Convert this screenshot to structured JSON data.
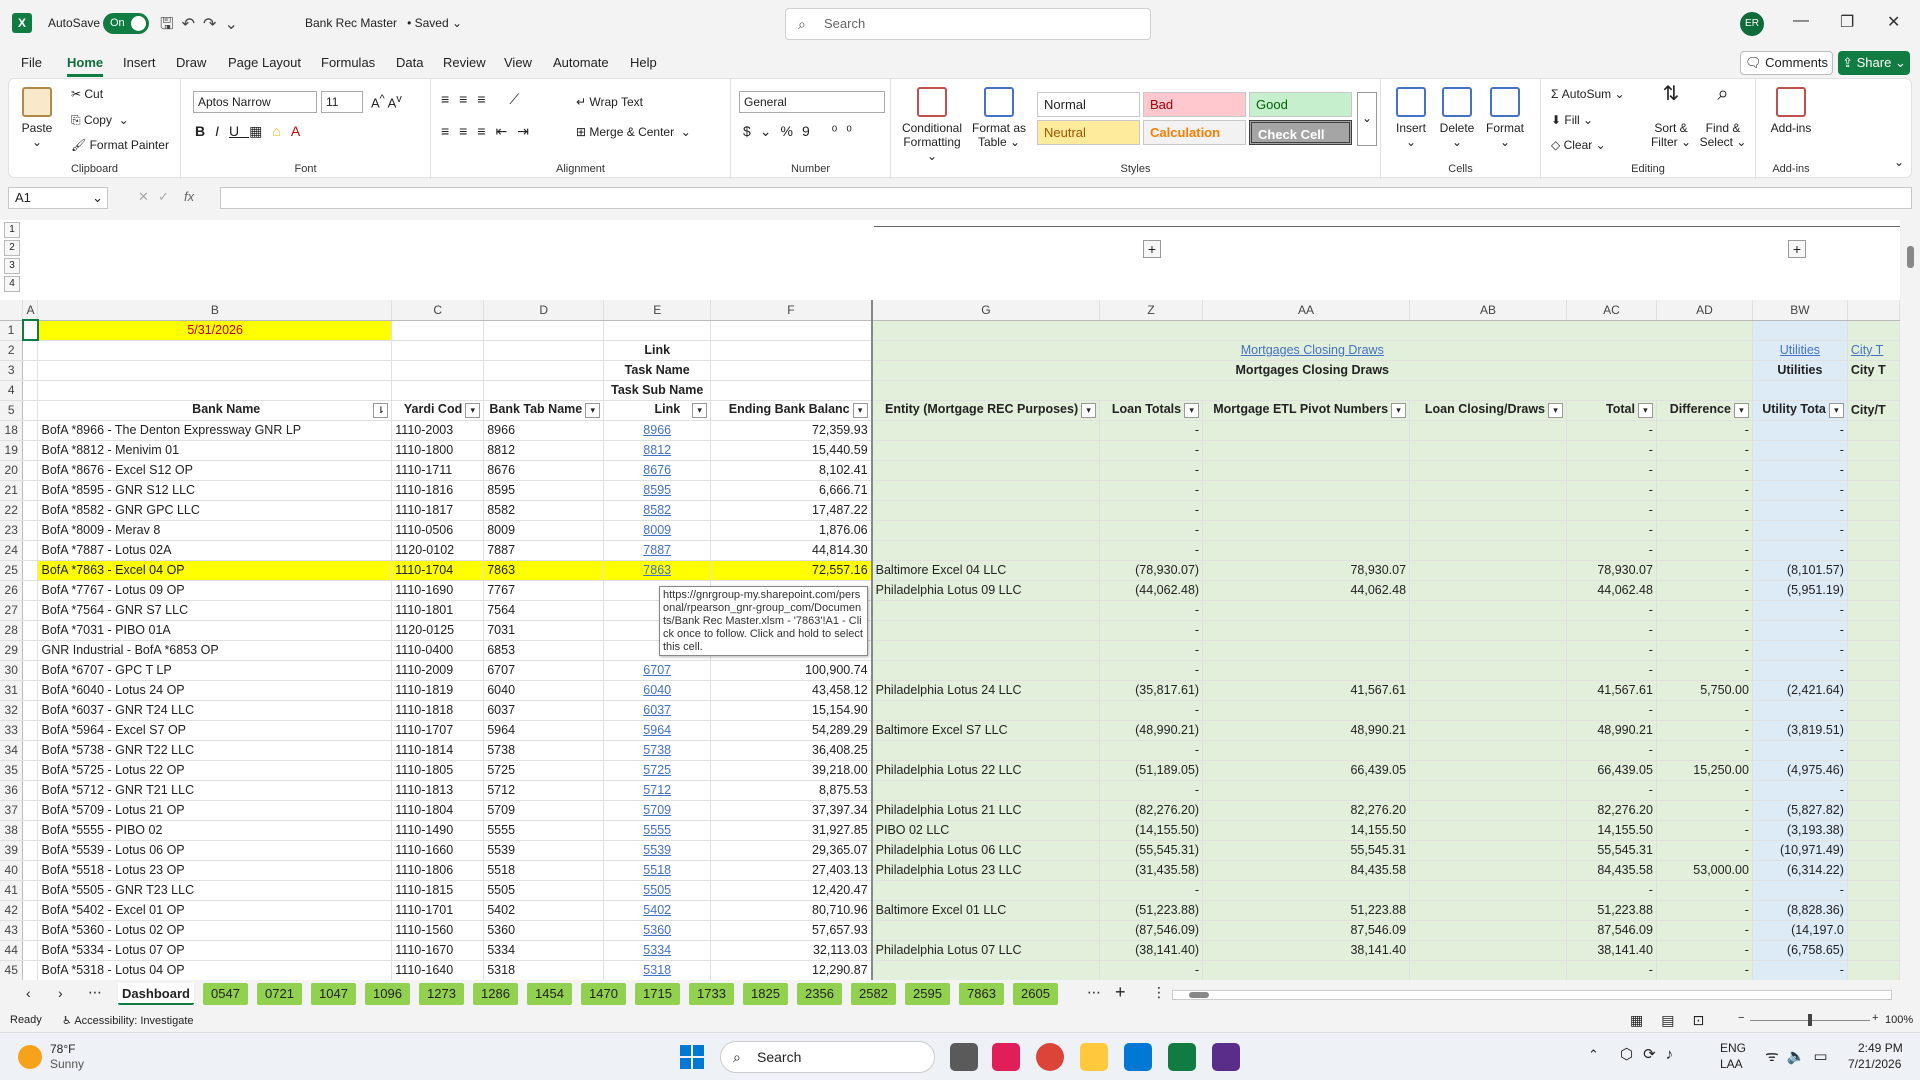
{
  "title_bar": {
    "app_icon": "X",
    "autosave_label": "AutoSave",
    "toggle_label": "On",
    "doc_title": "Bank Rec Master",
    "saved_label": "• Saved",
    "search_placeholder": "Search",
    "avatar": "ER"
  },
  "menu": [
    "File",
    "Home",
    "Insert",
    "Draw",
    "Page Layout",
    "Formulas",
    "Data",
    "Review",
    "View",
    "Automate",
    "Help"
  ],
  "menu_active": "Home",
  "comments_label": "Comments",
  "share_label": "Share",
  "ribbon": {
    "clipboard": {
      "paste": "Paste",
      "cut": "Cut",
      "copy": "Copy",
      "format_painter": "Format Painter",
      "label": "Clipboard"
    },
    "font": {
      "family": "Aptos Narrow",
      "size": "11",
      "label": "Font"
    },
    "alignment": {
      "wrap": "Wrap Text",
      "merge": "Merge & Center",
      "label": "Alignment"
    },
    "number": {
      "format": "General",
      "label": "Number"
    },
    "styles": {
      "conditional": "Conditional Formatting",
      "format_table": "Format as Table",
      "normal": "Normal",
      "bad": "Bad",
      "good": "Good",
      "neutral": "Neutral",
      "calculation": "Calculation",
      "check_cell": "Check Cell",
      "label": "Styles"
    },
    "cells": {
      "insert": "Insert",
      "delete": "Delete",
      "format": "Format",
      "label": "Cells"
    },
    "editing": {
      "autosum": "AutoSum",
      "fill": "Fill",
      "clear": "Clear",
      "sort": "Sort & Filter",
      "find": "Find & Select",
      "label": "Editing"
    },
    "addins": {
      "addins": "Add-ins",
      "label": "Add-ins"
    }
  },
  "formula_bar": {
    "name_box": "A1",
    "fx": "fx",
    "value": ""
  },
  "outline_levels": [
    "1",
    "2",
    "3",
    "4"
  ],
  "columns": [
    "A",
    "B",
    "C",
    "D",
    "E",
    "F",
    "G",
    "Z",
    "AA",
    "AB",
    "AC",
    "AD",
    "BW",
    ""
  ],
  "header_rows": {
    "r1_date": "5/31/2026",
    "r2_link": "Link",
    "r2_mortgages_link": "Mortgages Closing Draws",
    "r2_utilities_link": "Utilities",
    "r2_city_link": "City T",
    "r3_task_name": "Task Name",
    "r3_mortgages": "Mortgages Closing Draws",
    "r3_utilities": "Utilities",
    "r3_city": "City T",
    "r4_task_sub": "Task Sub Name",
    "r5": {
      "bank_name": "Bank Name",
      "yardi": "Yardi Cod",
      "bank_tab": "Bank Tab Name",
      "link": "Link",
      "ending": "Ending Bank Balanc",
      "entity": "Entity (Mortgage REC Purposes)",
      "loan_totals": "Loan Totals",
      "etl": "Mortgage ETL Pivot Numbers",
      "loan_closing": "Loan Closing/Draws",
      "total": "Total",
      "difference": "Difference",
      "utility": "Utility Tota",
      "city": "City/T"
    }
  },
  "rows": [
    {
      "n": "18",
      "bank": "BofA *8966 - The Denton Expressway GNR LP",
      "yardi": "1110-2003",
      "tab": "8966",
      "link": "8966",
      "bal": "72,359.93",
      "entity": "",
      "lt": "-",
      "etl": "",
      "lc": "",
      "tot": "-",
      "diff": "-",
      "util": "-"
    },
    {
      "n": "19",
      "bank": "BofA *8812 - Menivim 01",
      "yardi": "1110-1800",
      "tab": "8812",
      "link": "8812",
      "bal": "15,440.59",
      "entity": "",
      "lt": "-",
      "etl": "",
      "lc": "",
      "tot": "-",
      "diff": "-",
      "util": "-"
    },
    {
      "n": "20",
      "bank": "BofA *8676 - Excel S12 OP",
      "yardi": "1110-1711",
      "tab": "8676",
      "link": "8676",
      "bal": "8,102.41",
      "entity": "",
      "lt": "-",
      "etl": "",
      "lc": "",
      "tot": "-",
      "diff": "-",
      "util": "-"
    },
    {
      "n": "21",
      "bank": "BofA *8595 - GNR S12 LLC",
      "yardi": "1110-1816",
      "tab": "8595",
      "link": "8595",
      "bal": "6,666.71",
      "entity": "",
      "lt": "-",
      "etl": "",
      "lc": "",
      "tot": "-",
      "diff": "-",
      "util": "-"
    },
    {
      "n": "22",
      "bank": "BofA *8582 - GNR GPC LLC",
      "yardi": "1110-1817",
      "tab": "8582",
      "link": "8582",
      "bal": "17,487.22",
      "entity": "",
      "lt": "-",
      "etl": "",
      "lc": "",
      "tot": "-",
      "diff": "-",
      "util": "-"
    },
    {
      "n": "23",
      "bank": "BofA *8009 - Merav 8",
      "yardi": "1110-0506",
      "tab": "8009",
      "link": "8009",
      "bal": "1,876.06",
      "entity": "",
      "lt": "-",
      "etl": "",
      "lc": "",
      "tot": "-",
      "diff": "-",
      "util": "-"
    },
    {
      "n": "24",
      "bank": "BofA *7887 - Lotus 02A",
      "yardi": "1120-0102",
      "tab": "7887",
      "link": "7887",
      "bal": "44,814.30",
      "entity": "",
      "lt": "-",
      "etl": "",
      "lc": "",
      "tot": "-",
      "diff": "-",
      "util": "-"
    },
    {
      "n": "25",
      "bank": "BofA *7863 - Excel 04 OP",
      "yardi": "1110-1704",
      "tab": "7863",
      "link": "7863",
      "bal": "72,557.16",
      "entity": "Baltimore Excel 04 LLC",
      "lt": "(78,930.07)",
      "etl": "78,930.07",
      "lc": "",
      "tot": "78,930.07",
      "diff": "-",
      "util": "(8,101.57)",
      "hl": true
    },
    {
      "n": "26",
      "bank": "BofA *7767 - Lotus 09 OP",
      "yardi": "1110-1690",
      "tab": "7767",
      "link": "",
      "bal": "",
      "entity": "Philadelphia Lotus 09 LLC",
      "lt": "(44,062.48)",
      "etl": "44,062.48",
      "lc": "",
      "tot": "44,062.48",
      "diff": "-",
      "util": "(5,951.19)"
    },
    {
      "n": "27",
      "bank": "BofA *7564 - GNR S7 LLC",
      "yardi": "1110-1801",
      "tab": "7564",
      "link": "",
      "bal": "",
      "entity": "",
      "lt": "-",
      "etl": "",
      "lc": "",
      "tot": "-",
      "diff": "-",
      "util": "-"
    },
    {
      "n": "28",
      "bank": "BofA *7031 - PIBO 01A",
      "yardi": "1120-0125",
      "tab": "7031",
      "link": "",
      "bal": "",
      "entity": "",
      "lt": "-",
      "etl": "",
      "lc": "",
      "tot": "-",
      "diff": "-",
      "util": "-"
    },
    {
      "n": "29",
      "bank": "GNR Industrial - BofA *6853 OP",
      "yardi": "1110-0400",
      "tab": "6853",
      "link": "",
      "bal": "",
      "entity": "",
      "lt": "-",
      "etl": "",
      "lc": "",
      "tot": "-",
      "diff": "-",
      "util": "-"
    },
    {
      "n": "30",
      "bank": "BofA *6707 - GPC T LP",
      "yardi": "1110-2009",
      "tab": "6707",
      "link": "6707",
      "bal": "100,900.74",
      "entity": "",
      "lt": "-",
      "etl": "",
      "lc": "",
      "tot": "-",
      "diff": "-",
      "util": "-"
    },
    {
      "n": "31",
      "bank": "BofA *6040 - Lotus 24 OP",
      "yardi": "1110-1819",
      "tab": "6040",
      "link": "6040",
      "bal": "43,458.12",
      "entity": "Philadelphia Lotus 24 LLC",
      "lt": "(35,817.61)",
      "etl": "41,567.61",
      "lc": "",
      "tot": "41,567.61",
      "diff": "5,750.00",
      "util": "(2,421.64)"
    },
    {
      "n": "32",
      "bank": "BofA *6037 - GNR T24 LLC",
      "yardi": "1110-1818",
      "tab": "6037",
      "link": "6037",
      "bal": "15,154.90",
      "entity": "",
      "lt": "-",
      "etl": "",
      "lc": "",
      "tot": "-",
      "diff": "-",
      "util": "-"
    },
    {
      "n": "33",
      "bank": "BofA *5964 - Excel S7 OP",
      "yardi": "1110-1707",
      "tab": "5964",
      "link": "5964",
      "bal": "54,289.29",
      "entity": "Baltimore Excel S7 LLC",
      "lt": "(48,990.21)",
      "etl": "48,990.21",
      "lc": "",
      "tot": "48,990.21",
      "diff": "-",
      "util": "(3,819.51)"
    },
    {
      "n": "34",
      "bank": "BofA *5738 - GNR T22 LLC",
      "yardi": "1110-1814",
      "tab": "5738",
      "link": "5738",
      "bal": "36,408.25",
      "entity": "",
      "lt": "-",
      "etl": "",
      "lc": "",
      "tot": "-",
      "diff": "-",
      "util": "-"
    },
    {
      "n": "35",
      "bank": "BofA *5725 - Lotus 22 OP",
      "yardi": "1110-1805",
      "tab": "5725",
      "link": "5725",
      "bal": "39,218.00",
      "entity": "Philadelphia Lotus 22 LLC",
      "lt": "(51,189.05)",
      "etl": "66,439.05",
      "lc": "",
      "tot": "66,439.05",
      "diff": "15,250.00",
      "util": "(4,975.46)"
    },
    {
      "n": "36",
      "bank": "BofA *5712 - GNR T21 LLC",
      "yardi": "1110-1813",
      "tab": "5712",
      "link": "5712",
      "bal": "8,875.53",
      "entity": "",
      "lt": "-",
      "etl": "",
      "lc": "",
      "tot": "-",
      "diff": "-",
      "util": "-"
    },
    {
      "n": "37",
      "bank": "BofA *5709 - Lotus 21 OP",
      "yardi": "1110-1804",
      "tab": "5709",
      "link": "5709",
      "bal": "37,397.34",
      "entity": "Philadelphia Lotus 21 LLC",
      "lt": "(82,276.20)",
      "etl": "82,276.20",
      "lc": "",
      "tot": "82,276.20",
      "diff": "-",
      "util": "(5,827.82)"
    },
    {
      "n": "38",
      "bank": "BofA *5555 - PIBO 02",
      "yardi": "1110-1490",
      "tab": "5555",
      "link": "5555",
      "bal": "31,927.85",
      "entity": "PIBO 02 LLC",
      "lt": "(14,155.50)",
      "etl": "14,155.50",
      "lc": "",
      "tot": "14,155.50",
      "diff": "-",
      "util": "(3,193.38)"
    },
    {
      "n": "39",
      "bank": "BofA *5539 - Lotus 06 OP",
      "yardi": "1110-1660",
      "tab": "5539",
      "link": "5539",
      "bal": "29,365.07",
      "entity": "Philadelphia Lotus 06 LLC",
      "lt": "(55,545.31)",
      "etl": "55,545.31",
      "lc": "",
      "tot": "55,545.31",
      "diff": "-",
      "util": "(10,971.49)"
    },
    {
      "n": "40",
      "bank": "BofA *5518 - Lotus 23 OP",
      "yardi": "1110-1806",
      "tab": "5518",
      "link": "5518",
      "bal": "27,403.13",
      "entity": "Philadelphia Lotus 23 LLC",
      "lt": "(31,435.58)",
      "etl": "84,435.58",
      "lc": "",
      "tot": "84,435.58",
      "diff": "53,000.00",
      "util": "(6,314.22)"
    },
    {
      "n": "41",
      "bank": "BofA *5505 - GNR T23 LLC",
      "yardi": "1110-1815",
      "tab": "5505",
      "link": "5505",
      "bal": "12,420.47",
      "entity": "",
      "lt": "-",
      "etl": "",
      "lc": "",
      "tot": "-",
      "diff": "-",
      "util": "-"
    },
    {
      "n": "42",
      "bank": "BofA *5402 - Excel 01 OP",
      "yardi": "1110-1701",
      "tab": "5402",
      "link": "5402",
      "bal": "80,710.96",
      "entity": "Baltimore Excel 01 LLC",
      "lt": "(51,223.88)",
      "etl": "51,223.88",
      "lc": "",
      "tot": "51,223.88",
      "diff": "-",
      "util": "(8,828.36)"
    },
    {
      "n": "43",
      "bank": "BofA *5360 - Lotus 02 OP",
      "yardi": "1110-1560",
      "tab": "5360",
      "link": "5360",
      "bal": "57,657.93",
      "entity": "",
      "lt": "(87,546.09)",
      "etl": "87,546.09",
      "lc": "",
      "tot": "87,546.09",
      "diff": "-",
      "util": "(14,197.0"
    },
    {
      "n": "44",
      "bank": "BofA *5334 - Lotus 07 OP",
      "yardi": "1110-1670",
      "tab": "5334",
      "link": "5334",
      "bal": "32,113.03",
      "entity": "Philadelphia Lotus 07 LLC",
      "lt": "(38,141.40)",
      "etl": "38,141.40",
      "lc": "",
      "tot": "38,141.40",
      "diff": "-",
      "util": "(6,758.65)"
    },
    {
      "n": "45",
      "bank": "BofA *5318 - Lotus 04 OP",
      "yardi": "1110-1640",
      "tab": "5318",
      "link": "5318",
      "bal": "12,290.87",
      "entity": "",
      "lt": "-",
      "etl": "",
      "lc": "",
      "tot": "-",
      "diff": "-",
      "util": "-"
    }
  ],
  "tooltip": "https://gnrgroup-my.sharepoint.com/personal/rpearson_gnr-group_com/Documents/Bank Rec Master.xlsm - '7863'!A1 - Click once to follow. Click and hold to select this cell.",
  "sheet_tabs": [
    "Dashboard",
    "0547",
    "0721",
    "1047",
    "1096",
    "1273",
    "1286",
    "1454",
    "1470",
    "1715",
    "1733",
    "1825",
    "2356",
    "2582",
    "2595",
    "7863",
    "2605"
  ],
  "status": {
    "ready": "Ready",
    "accessibility": "Accessibility: Investigate",
    "zoom": "100%"
  },
  "taskbar": {
    "temp": "78°F",
    "weather": "Sunny",
    "search": "Search",
    "lang1": "ENG",
    "lang2": "LAA",
    "time": "2:49 PM",
    "date": "7/21/2026"
  }
}
